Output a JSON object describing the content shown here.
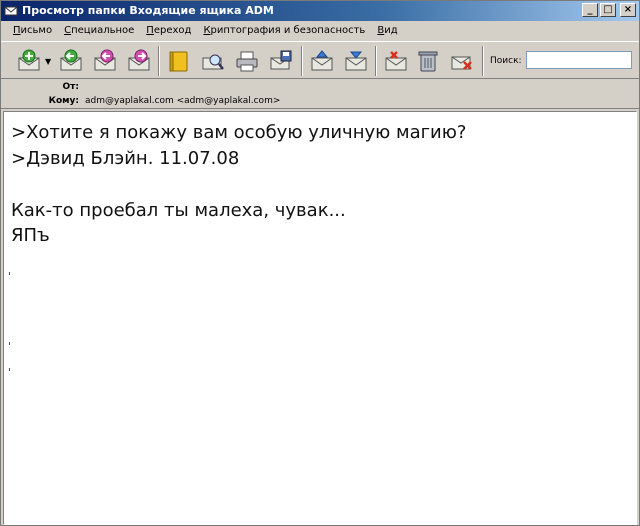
{
  "window": {
    "title": "Просмотр папки Входящие ящика ADM",
    "controls": [
      "_",
      "□",
      "×"
    ]
  },
  "menu": [
    {
      "label": "Письмо",
      "accel": "П"
    },
    {
      "label": "Специальное",
      "accel": "С"
    },
    {
      "label": "Переход",
      "accel": "П"
    },
    {
      "label": "Криптография и безопасность",
      "accel": "К"
    },
    {
      "label": "Вид",
      "accel": "В"
    }
  ],
  "toolbar": {
    "icons": [
      "new-message-icon",
      "reply-icon",
      "reply-all-icon",
      "forward-icon",
      "address-book-icon",
      "find-icon",
      "print-icon",
      "save-icon",
      "move-up-icon",
      "move-down-icon",
      "mark-unread-icon",
      "trash-icon",
      "delete-icon"
    ],
    "search_label": "Поиск:",
    "search_value": ""
  },
  "headers": {
    "from_label": "От:",
    "from_value": "",
    "to_label": "Кому:",
    "to_value": "adm@yaplakal.com <adm@yaplakal.com>"
  },
  "message": {
    "lines": [
      ">Хотите я покажу вам особую уличную магию?",
      ">Дэвид Блэйн. 11.07.08",
      "Как-то проебал ты малеха, чувак...",
      "ЯПъ"
    ]
  },
  "colors": {
    "titlebar_start": "#0a246a",
    "titlebar_end": "#a6caf0",
    "chrome": "#d4d0c8",
    "body_bg": "#ffffff"
  }
}
